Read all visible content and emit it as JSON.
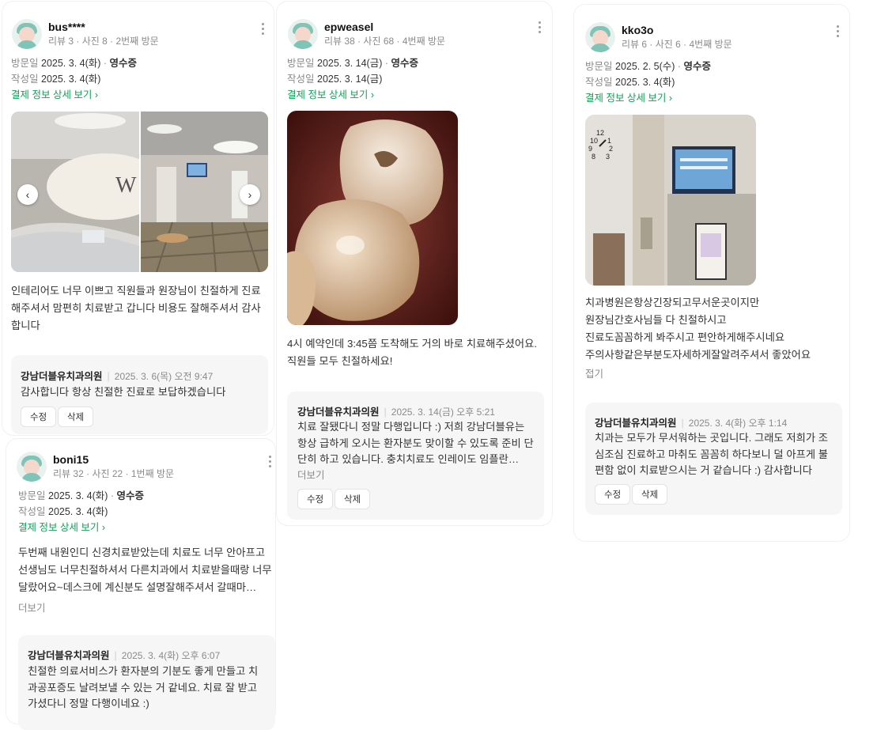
{
  "reviews": [
    {
      "user": {
        "name": "bus****",
        "meta": "리뷰 3 · 사진 8 · 2번째 방문"
      },
      "visit_label": "방문일",
      "visit_date": "2025. 3. 4(화)",
      "receipt": "영수증",
      "written_label": "작성일",
      "written_date": "2025. 3. 4(화)",
      "pay_link": "결제 정보 상세 보기 ›",
      "photos": [
        "interior-reception-photo",
        "interior-lobby-photo"
      ],
      "text": "인테리어도 너무 이쁘고 직원들과 원장님이 친절하게 진료해주셔서 맘편히 치료받고 갑니다 비용도 잘해주셔서 감사합니다",
      "reply": {
        "name": "강남더블유치과의원",
        "date": "2025. 3. 6(목) 오전 9:47",
        "text": "감사합니다 항상 친절한 진료로 보답하겠습니다"
      }
    },
    {
      "user": {
        "name": "epweasel",
        "meta": "리뷰 38 · 사진 68 · 4번째 방문"
      },
      "visit_label": "방문일",
      "visit_date": "2025. 3. 14(금)",
      "receipt": "영수증",
      "written_label": "작성일",
      "written_date": "2025. 3. 14(금)",
      "pay_link": "결제 정보 상세 보기 ›",
      "photos": [
        "tooth-closeup-photo"
      ],
      "text": "4시 예약인데 3:45쯤 도착해도 거의 바로 치료해주셨어요. 직원들 모두 친절하세요!",
      "reply": {
        "name": "강남더블유치과의원",
        "date": "2025. 3. 14(금) 오후 5:21",
        "text": "치료 잘됐다니 정말 다행입니다 :) 저희 강남더블유는 항상 급하게 오시는 환자분도 맞이할 수 있도록 준비 단단히 하고 있습니다. 충치치료도 인레이도 임플란…",
        "more": "더보기"
      }
    },
    {
      "user": {
        "name": "kko3o",
        "meta": "리뷰 6 · 사진 6 · 4번째 방문"
      },
      "visit_label": "방문일",
      "visit_date": "2025. 2. 5(수)",
      "receipt": "영수증",
      "written_label": "작성일",
      "written_date": "2025. 3. 4(화)",
      "pay_link": "결제 정보 상세 보기 ›",
      "photos": [
        "clinic-entrance-photo"
      ],
      "text_lines": [
        "치과병원은항상긴장되고무서운곳이지만",
        "원장님간호사님들 다 친절하시고",
        "진료도꼼꼼하게 봐주시고 편안하게해주시네요",
        "주의사항같은부분도자세하게잘알려주셔서 좋았어요"
      ],
      "collapse": "접기",
      "reply": {
        "name": "강남더블유치과의원",
        "date": "2025. 3. 4(화) 오후 1:14",
        "text": "치과는 모두가 무서워하는 곳입니다. 그래도 저희가 조심조심 진료하고 마취도 꼼꼼히 하다보니 덜 아프게 불편함 없이 치료받으시는 거 같습니다 :) 감사합니다"
      }
    },
    {
      "user": {
        "name": "boni15",
        "meta": "리뷰 32 · 사진 22 · 1번째 방문"
      },
      "visit_label": "방문일",
      "visit_date": "2025. 3. 4(화)",
      "receipt": "영수증",
      "written_label": "작성일",
      "written_date": "2025. 3. 4(화)",
      "pay_link": "결제 정보 상세 보기 ›",
      "text": "두번째 내원인디 신경치료받았는데 치료도 너무 안아프고 선생님도 너무친절하셔서 다른치과에서 치료받을때랑 너무달랐어요~데스크에 계신분도 설명잘해주셔서 갈때마…",
      "more": "더보기",
      "reply": {
        "name": "강남더블유치과의원",
        "date": "2025. 3. 4(화) 오후 6:07",
        "text": "친절한 의료서비스가 환자분의 기분도 좋게 만들고 치과공포증도 날려보낼 수 있는 거 같네요. 치료 잘 받고 가셨다니 정말 다행이네요 :)"
      }
    }
  ],
  "buttons": {
    "edit": "수정",
    "delete": "삭제"
  },
  "icons": {
    "more": "more-vertical-icon",
    "prev": "chevron-left-icon",
    "next": "chevron-right-icon"
  },
  "colors": {
    "link": "#12a05a",
    "meta": "#8a8a8a",
    "reply_bg": "#f6f6f6"
  }
}
